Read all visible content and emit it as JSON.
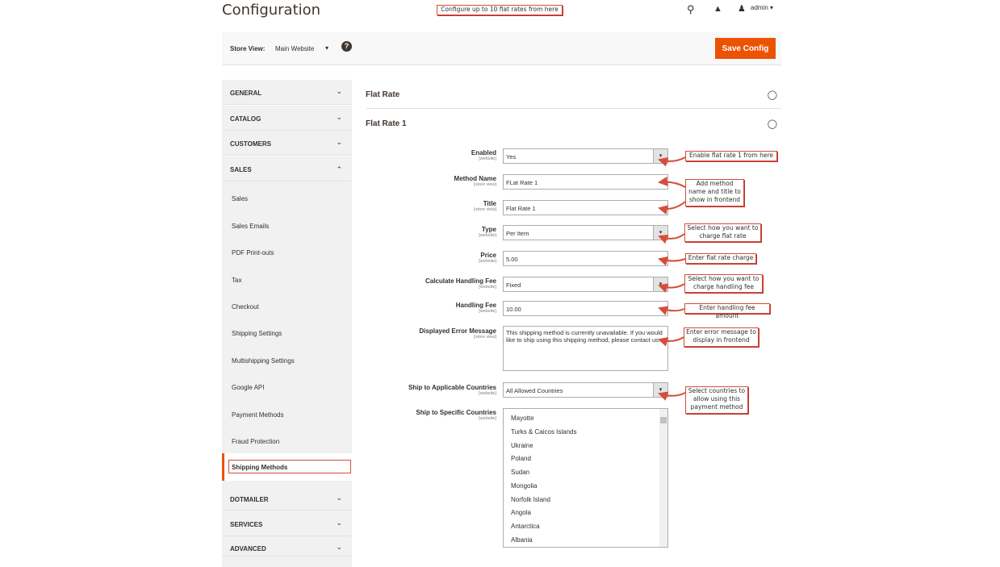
{
  "header": {
    "title": "Configuration",
    "top_note": "Configure up to 10 flat rates from here",
    "user": "admin ▾"
  },
  "store": {
    "label": "Store View:",
    "value": "Main Website",
    "save": "Save Config"
  },
  "sidebar": {
    "tabs": [
      "GENERAL",
      "CATALOG",
      "CUSTOMERS",
      "SALES",
      "DOTMAILER",
      "SERVICES",
      "ADVANCED"
    ],
    "sales_items": [
      "Sales",
      "Sales Emails",
      "PDF Print-outs",
      "Tax",
      "Checkout",
      "Shipping Settings",
      "Multishipping Settings",
      "Google API",
      "Payment Methods",
      "Fraud Protection",
      "Shipping Methods"
    ]
  },
  "main": {
    "section": "Flat Rate",
    "group": "Flat Rate 1",
    "fields": [
      {
        "label": "Enabled",
        "scope": "[website]",
        "value": "Yes"
      },
      {
        "label": "Method Name",
        "scope": "[store view]",
        "value": "FLat Rate 1"
      },
      {
        "label": "Title",
        "scope": "[store view]",
        "value": "Flat Rate 1"
      },
      {
        "label": "Type",
        "scope": "[website]",
        "value": "Per Item"
      },
      {
        "label": "Price",
        "scope": "[website]",
        "value": "5.00"
      },
      {
        "label": "Calculate Handling Fee",
        "scope": "[website]",
        "value": "Fixed"
      },
      {
        "label": "Handling Fee",
        "scope": "[website]",
        "value": "10.00"
      },
      {
        "label": "Displayed Error Message",
        "scope": "[store view]",
        "value": "This shipping method is currently unavailable. If you would like to ship using this shipping method, please contact us."
      },
      {
        "label": "Ship to Applicable Countries",
        "scope": "[website]",
        "value": "All Allowed Countries"
      },
      {
        "label": "Ship to Specific Countries",
        "scope": "[website]"
      }
    ],
    "countries": [
      "Mayotte",
      "Turks & Caicos Islands",
      "Ukraine",
      "Poland",
      "Sudan",
      "Mongolia",
      "Norfolk Island",
      "Angola",
      "Antarctica",
      "Albania"
    ]
  },
  "notes": [
    "Enable flat rate 1 from here",
    "Add method name and title to show in frontend",
    "Select how you want to charge flat rate",
    "Enter flat rate charge",
    "Select how you want to charge handling fee",
    "Enter handling fee amount",
    "Enter error message to display in frontend",
    "Select countries to allow using this payment method"
  ],
  "colors": {
    "accent": "#eb5202",
    "annotation": "#d64d3a"
  }
}
